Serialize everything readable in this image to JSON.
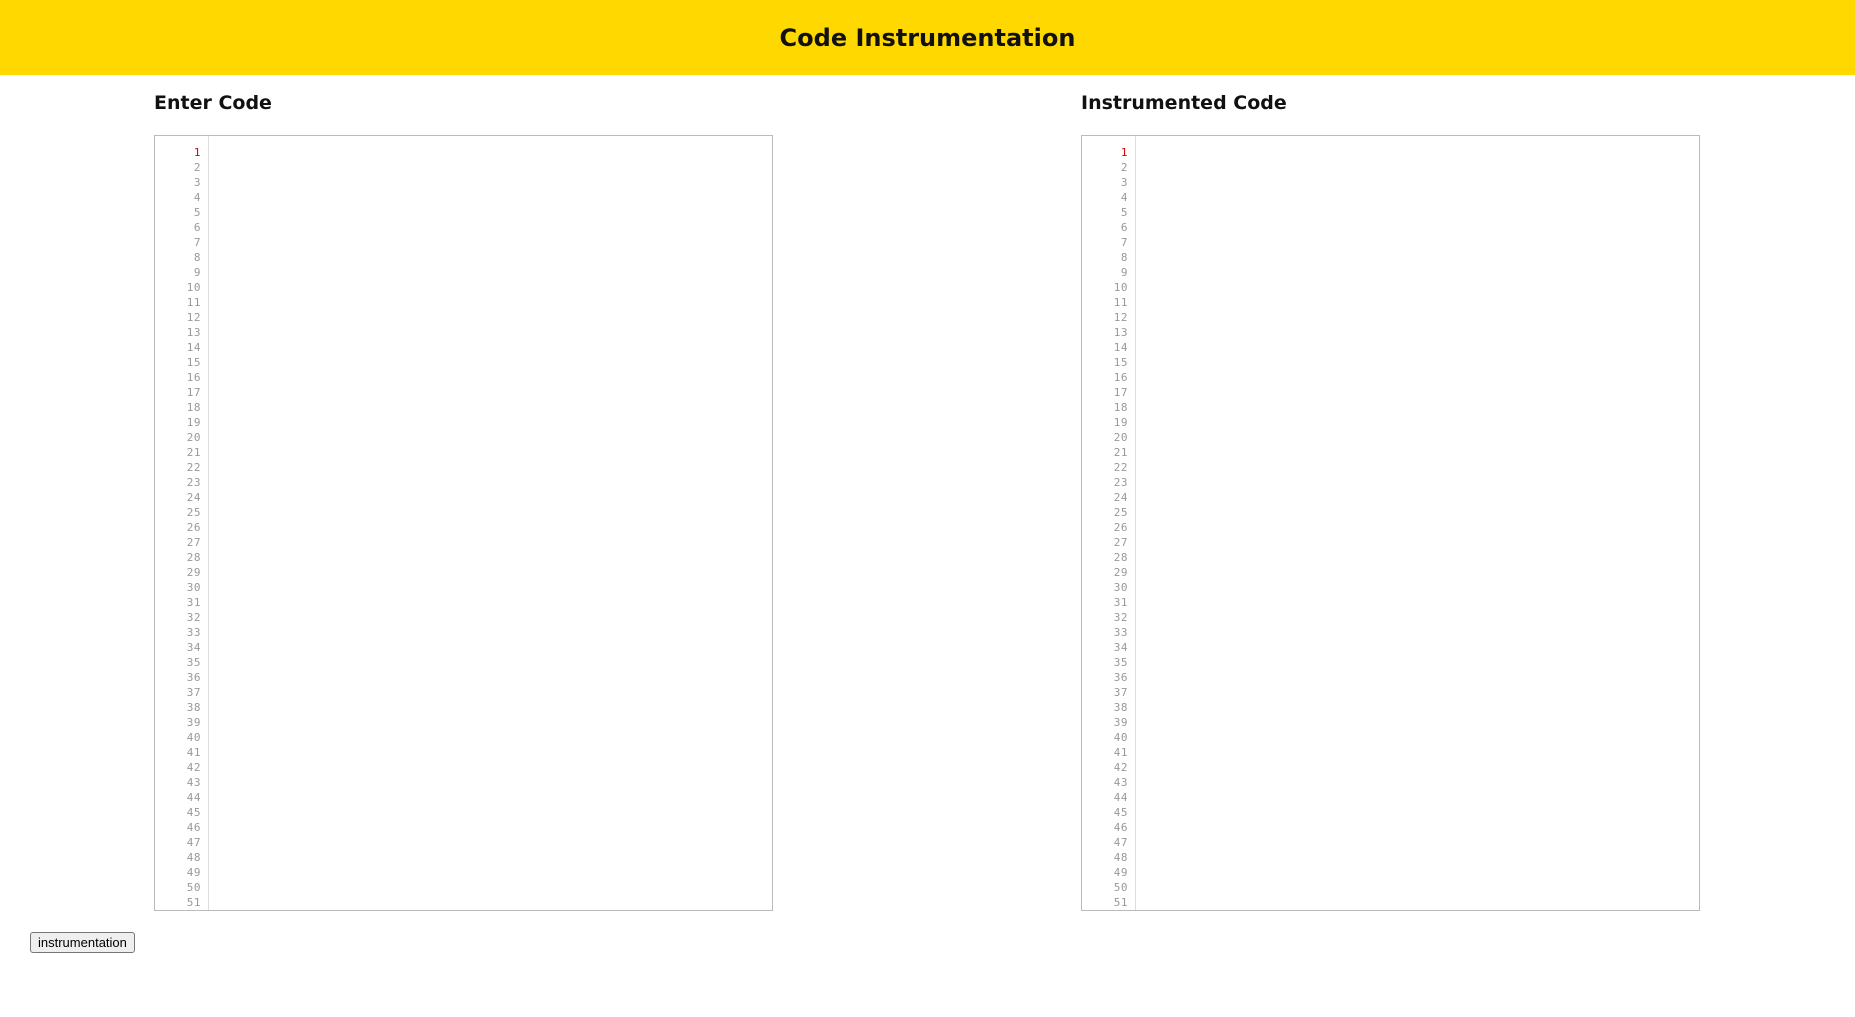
{
  "header": {
    "title": "Code Instrumentation",
    "background_color": "#ffd800"
  },
  "input_panel": {
    "title": "Enter Code",
    "code": "",
    "active_line": 1,
    "line_count": 51
  },
  "output_panel": {
    "title": "Instrumented Code",
    "code": "",
    "active_line": 1,
    "line_count": 51
  },
  "actions": {
    "instrument_label": "instrumentation"
  }
}
